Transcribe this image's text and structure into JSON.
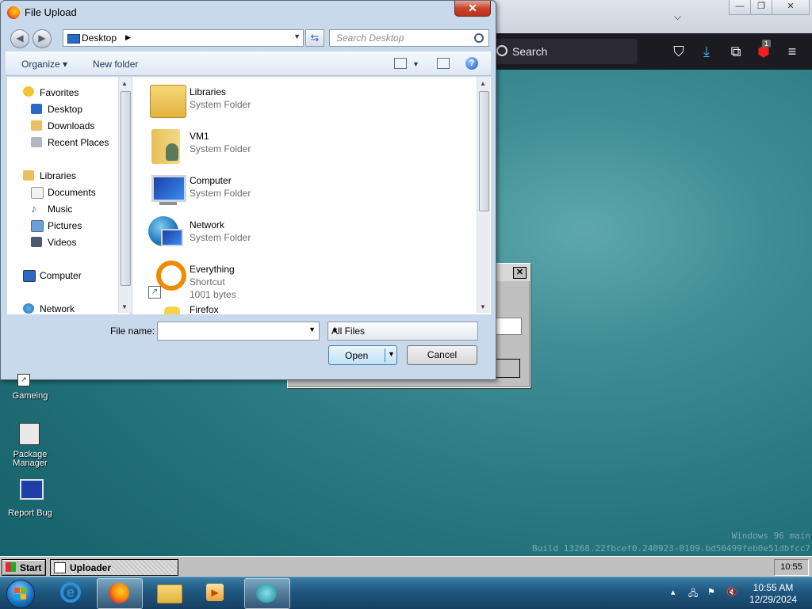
{
  "dialog": {
    "title": "File Upload",
    "close_label": "✕",
    "address": "Desktop",
    "search_placeholder": "Search Desktop",
    "toolbar": {
      "organize": "Organize",
      "new_folder": "New folder",
      "help": "?"
    },
    "nav": {
      "favorites": "Favorites",
      "desktop": "Desktop",
      "downloads": "Downloads",
      "recent_places": "Recent Places",
      "libraries": "Libraries",
      "documents": "Documents",
      "music": "Music",
      "pictures": "Pictures",
      "videos": "Videos",
      "computer": "Computer",
      "network": "Network"
    },
    "items": [
      {
        "name": "Libraries",
        "type": "System Folder"
      },
      {
        "name": "VM1",
        "type": "System Folder"
      },
      {
        "name": "Computer",
        "type": "System Folder"
      },
      {
        "name": "Network",
        "type": "System Folder"
      },
      {
        "name": "Everything",
        "type": "Shortcut",
        "size": "1001 bytes"
      },
      {
        "name": "Firefox"
      }
    ],
    "file_name_label": "File name:",
    "file_name_value": "",
    "filter": "All Files",
    "open_label": "Open",
    "cancel_label": "Cancel"
  },
  "browser": {
    "search_label": "Search",
    "badge": "1"
  },
  "desktop_icons": [
    {
      "label": "Gameing"
    },
    {
      "label": "Package Manager"
    },
    {
      "label": "Report Bug"
    }
  ],
  "w96_taskbar": {
    "start": "Start",
    "task": "Uploader",
    "clock": "10:55"
  },
  "watermark": {
    "line1": "Windows 96 main",
    "line2": "Build 13268.22fbcef0.240923-0109.bd50499feb0e51dbfcc7"
  },
  "win7_taskbar": {
    "time": "10:55 AM",
    "date": "12/29/2024"
  },
  "colors": {
    "dialog_frame": "#c9d9ec",
    "desktop": "#2b7b84",
    "taskbar": "#205a82"
  }
}
